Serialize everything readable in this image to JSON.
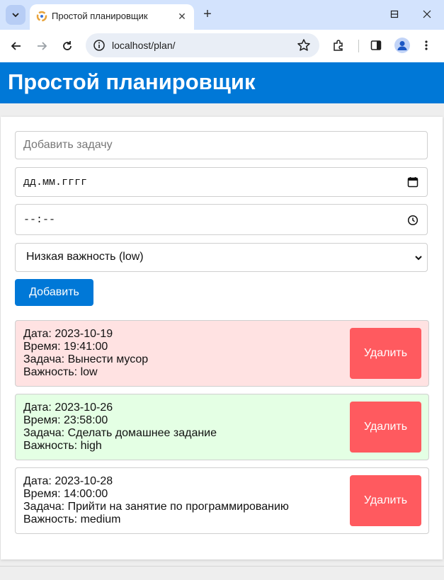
{
  "browser": {
    "tab_title": "Простой планировщик",
    "url": "localhost/plan/"
  },
  "app": {
    "title": "Простой планировщик"
  },
  "form": {
    "task_placeholder": "Добавить задачу",
    "date_placeholder": "дд.мм.гггг",
    "time_placeholder": "--:--",
    "priority_selected": "Низкая важность (low)",
    "add_label": "Добавить"
  },
  "tasks": [
    {
      "date": "Дата: 2023-10-19",
      "time": "Время: 19:41:00",
      "task": "Задача: Вынести мусор",
      "priority": "Важность: low",
      "bg": "#ffe2e2",
      "delete_label": "Удалить"
    },
    {
      "date": "Дата: 2023-10-26",
      "time": "Время: 23:58:00",
      "task": "Задача: Сделать домашнее задание",
      "priority": "Важность: high",
      "bg": "#e4ffe4",
      "delete_label": "Удалить"
    },
    {
      "date": "Дата: 2023-10-28",
      "time": "Время: 14:00:00",
      "task": "Задача: Прийти на занятие по программированию",
      "priority": "Важность: medium",
      "bg": "#ffffff",
      "delete_label": "Удалить"
    }
  ],
  "colors": {
    "header": "#0078d7",
    "delete": "#ff5a5f"
  }
}
